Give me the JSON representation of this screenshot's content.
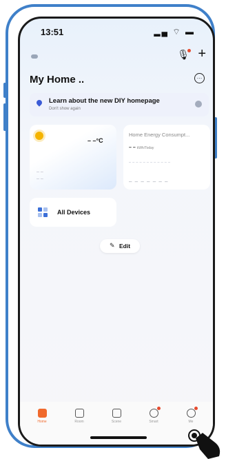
{
  "status_bar": {
    "time": "13:51",
    "icons": "▂▄ ⌔ ▬"
  },
  "header": {
    "title": "My Home ..",
    "more_icon": "…"
  },
  "banner": {
    "title": "Learn about the new DIY homepage",
    "subtitle": "Don't show again"
  },
  "weather": {
    "temp": "– –°C",
    "lines": "– –\n– –"
  },
  "energy": {
    "title": "Home Energy Consumpt...",
    "value": "– –",
    "unit": "kWh/Today",
    "dashes": "– – – – – – –"
  },
  "devices": {
    "label": "All Devices"
  },
  "edit": {
    "label": "Edit",
    "icon": "✎"
  },
  "tabs": [
    {
      "label": "Home",
      "active": true
    },
    {
      "label": "Room",
      "active": false
    },
    {
      "label": "Scene",
      "active": false
    },
    {
      "label": "Smart",
      "active": false
    },
    {
      "label": "Me",
      "active": false
    }
  ],
  "colors": {
    "accent": "#f06a2d",
    "frame": "#3f80c9",
    "banner_pin": "#3b5bd6",
    "sun": "#f5b400"
  }
}
